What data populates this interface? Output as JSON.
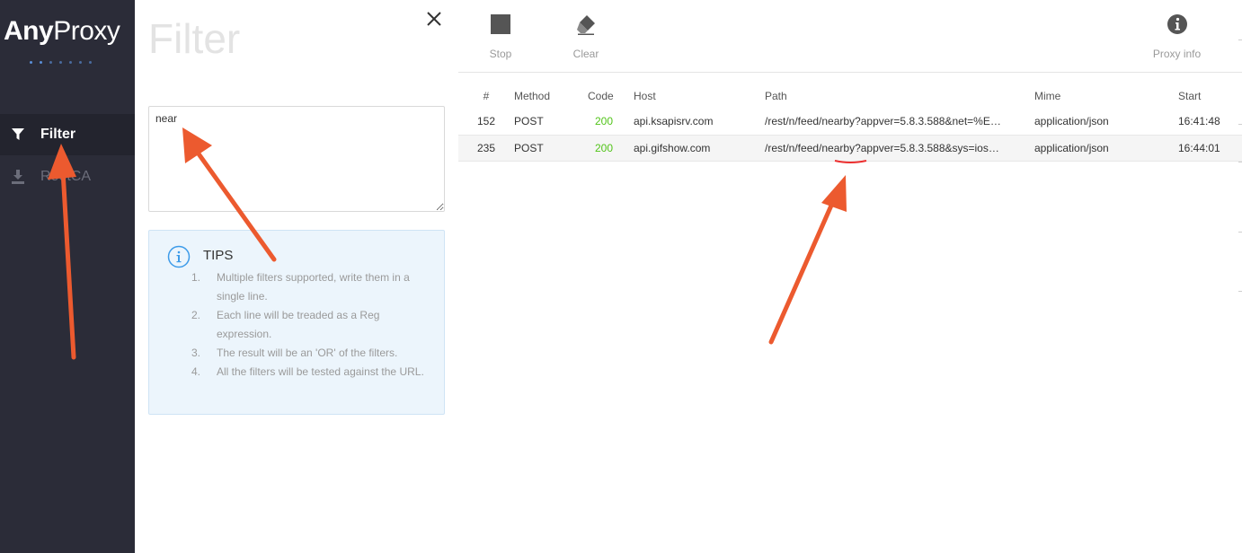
{
  "app": {
    "logo_bold": "Any",
    "logo_light": "Proxy"
  },
  "sidebar": {
    "items": [
      {
        "label": "Filter",
        "icon": "filter-icon",
        "active": true
      },
      {
        "label": "RootCA",
        "icon": "download-icon",
        "active": false
      }
    ]
  },
  "filter_panel": {
    "title": "Filter",
    "input_value": "near",
    "tips": {
      "title": "TIPS",
      "items": [
        {
          "num": "1.",
          "text": "Multiple filters supported, write them in a single line."
        },
        {
          "num": "2.",
          "text": "Each line will be treaded as a Reg expression."
        },
        {
          "num": "3.",
          "text": "The result will be an 'OR' of the filters."
        },
        {
          "num": "4.",
          "text": "All the filters will be tested against the URL."
        }
      ]
    }
  },
  "toolbar": {
    "stop_label": "Stop",
    "clear_label": "Clear",
    "info_label": "Proxy info"
  },
  "table": {
    "columns": [
      "#",
      "Method",
      "Code",
      "Host",
      "Path",
      "Mime",
      "Start"
    ],
    "rows": [
      {
        "id": "152",
        "method": "POST",
        "code": "200",
        "host": "api.ksapisrv.com",
        "path": "/rest/n/feed/nearby?appver=5.8.3.588&net=%E…",
        "mime": "application/json",
        "start": "16:41:48"
      },
      {
        "id": "235",
        "method": "POST",
        "code": "200",
        "host": "api.gifshow.com",
        "path_prefix": "/rest/n/feed/",
        "path_match": "nearby",
        "path_suffix": "?appver=5.8.3.588&sys=ios…",
        "mime": "application/json",
        "start": "16:44:01"
      }
    ]
  },
  "colors": {
    "sidebar_bg": "#2b2c38",
    "status_ok": "#52c41a",
    "annotation": "#ec5a2f",
    "tips_bg": "#ecf5fc"
  }
}
